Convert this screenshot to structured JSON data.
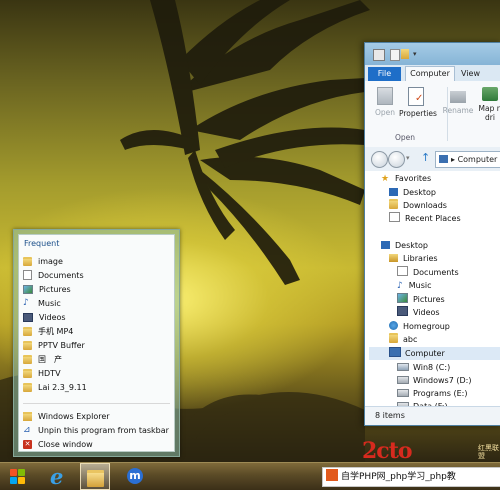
{
  "jump_list": {
    "header": "Frequent",
    "items": [
      {
        "label": "image",
        "icon": "folder-icon"
      },
      {
        "label": "Documents",
        "icon": "documents-icon"
      },
      {
        "label": "Pictures",
        "icon": "pictures-icon"
      },
      {
        "label": "Music",
        "icon": "music-icon"
      },
      {
        "label": "Videos",
        "icon": "videos-icon"
      },
      {
        "label": "手机 MP4",
        "icon": "folder-icon"
      },
      {
        "label": "PPTV Buffer",
        "icon": "folder-icon"
      },
      {
        "label": "国　产",
        "icon": "folder-icon"
      },
      {
        "label": "HDTV",
        "icon": "folder-icon"
      },
      {
        "label": "Lai 2.3_9.11",
        "icon": "folder-icon"
      }
    ],
    "tasks": [
      {
        "label": "Windows Explorer",
        "icon": "folder-icon"
      },
      {
        "label": "Unpin this program from taskbar",
        "icon": "unpin-icon"
      },
      {
        "label": "Close window",
        "icon": "close-icon"
      }
    ]
  },
  "explorer": {
    "tabs": {
      "file": "File",
      "computer": "Computer",
      "view": "View"
    },
    "ribbon": {
      "open": "Open",
      "properties": "Properties",
      "rename": "Rename",
      "map_line1": "Map n",
      "map_line2": "dri",
      "group_label": "Open"
    },
    "address": "Computer",
    "nav": {
      "favorites": "Favorites",
      "desktop_fav": "Desktop",
      "downloads": "Downloads",
      "recent_places": "Recent Places",
      "desktop": "Desktop",
      "libraries": "Libraries",
      "lib_documents": "Documents",
      "lib_music": "Music",
      "lib_pictures": "Pictures",
      "lib_videos": "Videos",
      "homegroup": "Homegroup",
      "abc": "abc",
      "computer": "Computer",
      "drive_c": "Win8 (C:)",
      "drive_d": "Windows7 (D:)",
      "drive_e": "Programs (E:)",
      "drive_f": "Data (F:)"
    },
    "status": "8 items"
  },
  "watermark": {
    "logo_main": "2cto",
    "logo_side": "红黑联盟",
    "bar_text": "自学PHP网_php学习_php教"
  },
  "colors": {
    "file_tab": "#1e6ec8",
    "taskbar": "#5a4a26",
    "selection": "#dce9f6"
  }
}
